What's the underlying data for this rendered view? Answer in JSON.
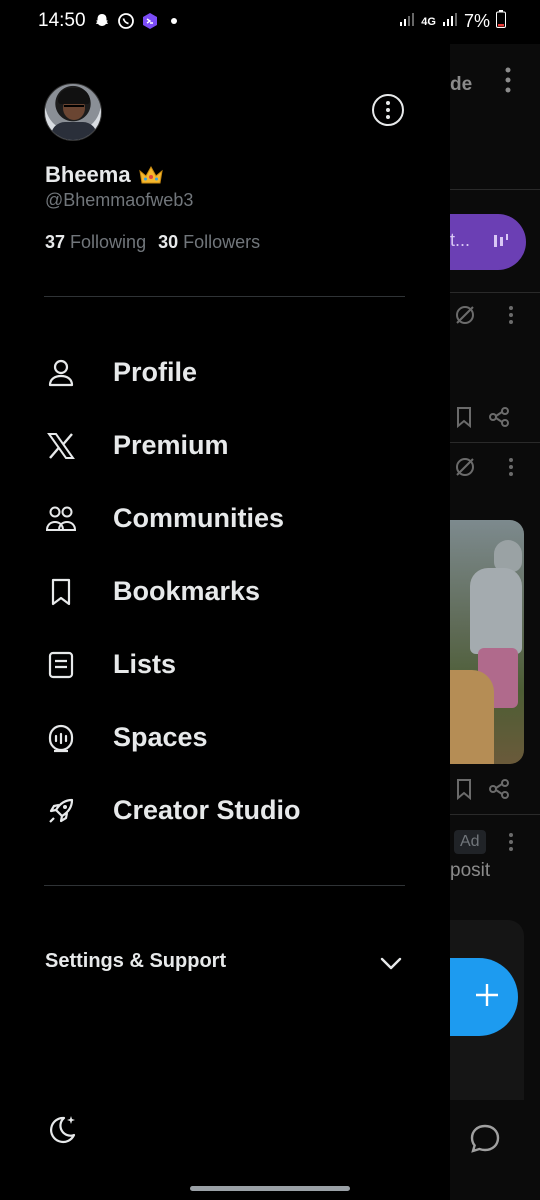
{
  "status_bar": {
    "time": "14:50",
    "battery": "7%",
    "network": "4G"
  },
  "profile": {
    "display_name": "Bheema",
    "handle": "@Bhemmaofweb3",
    "following_count": "37",
    "following_label": "Following",
    "followers_count": "30",
    "followers_label": "Followers"
  },
  "nav": {
    "items": [
      {
        "label": "Profile",
        "icon": "person-icon"
      },
      {
        "label": "Premium",
        "icon": "x-logo-icon"
      },
      {
        "label": "Communities",
        "icon": "communities-icon"
      },
      {
        "label": "Bookmarks",
        "icon": "bookmark-icon"
      },
      {
        "label": "Lists",
        "icon": "list-icon"
      },
      {
        "label": "Spaces",
        "icon": "spaces-icon"
      },
      {
        "label": "Creator Studio",
        "icon": "rocket-icon"
      }
    ]
  },
  "settings": {
    "label": "Settings & Support"
  },
  "feed": {
    "header_fragment": "de",
    "pill_fragment": "t...",
    "ad_badge": "Ad",
    "ad_text_fragment": "posit"
  },
  "colors": {
    "background": "#000000",
    "text_primary": "#e7e9ea",
    "text_secondary": "#71767b",
    "accent_blue": "#1d9bf0",
    "spaces_purple": "#6b3fb4"
  }
}
